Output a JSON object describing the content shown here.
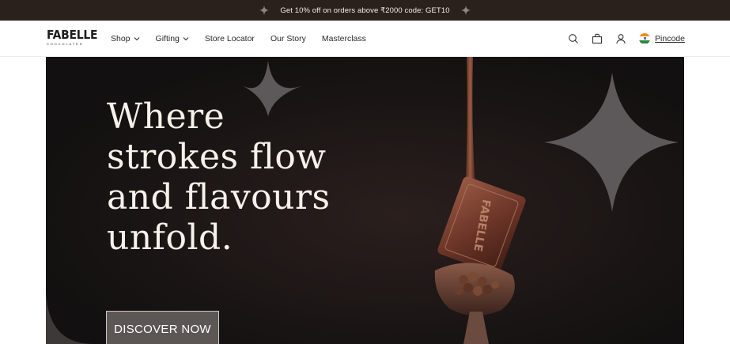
{
  "announcement": {
    "text": "Get 10% off on orders above ₹2000 code: GET10"
  },
  "header": {
    "logo_text": "FABELLE",
    "logo_subtext": "CHOCOLATES",
    "nav": [
      {
        "label": "Shop",
        "has_dropdown": true
      },
      {
        "label": "Gifting",
        "has_dropdown": true
      },
      {
        "label": "Store Locator",
        "has_dropdown": false
      },
      {
        "label": "Our Story",
        "has_dropdown": false
      },
      {
        "label": "Masterclass",
        "has_dropdown": false
      }
    ],
    "icons": [
      "search-icon",
      "bag-icon",
      "user-icon",
      "india-flag-icon"
    ],
    "pincode_label": "Pincode"
  },
  "hero": {
    "headline_lines": [
      "Where",
      "strokes flow",
      "and flavours",
      "unfold."
    ],
    "cta_label": "DISCOVER NOW",
    "bar_engraving": "FABELLE"
  },
  "colors": {
    "announcement_bg": "#2b211c",
    "hero_bg": "#141011",
    "headline": "#f6f1ea",
    "sparkle": "#5d5859",
    "chocolate": "#6e3b2c"
  }
}
